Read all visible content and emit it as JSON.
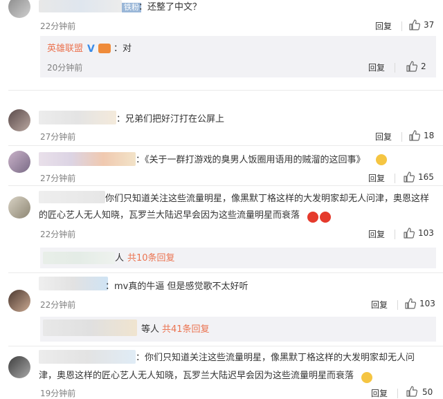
{
  "comments": [
    {
      "user_tag": "铁粉",
      "text": "：还整了中文？",
      "time": "22分钟前",
      "reply": "回复",
      "likes": "37"
    },
    {
      "username": "英雄联盟",
      "text": "：对",
      "time": "20分钟前",
      "reply": "回复",
      "likes": "2"
    },
    {
      "text": "：兄弟们把好汀打在公屏上",
      "time": "27分钟前",
      "reply": "回复",
      "likes": "18"
    },
    {
      "text": "：《关于一群打游戏的臭男人饭圈用语用的贼溜的这回事》",
      "time": "27分钟前",
      "reply": "回复",
      "likes": "165"
    },
    {
      "text_line1": "你们只知道关注这些流量明星，像黑默丁格这样的大发明家却无人问津，奥恩这样",
      "text_line2": "的匠心艺人无人知晓，瓦罗兰大陆迟早会因为这些流量明星而衰落",
      "time": "22分钟前",
      "reply": "回复",
      "likes": "103",
      "more_text": "人",
      "more_link": "共10条回复"
    },
    {
      "text": "：mv真的牛逼 但是感觉歌不太好听",
      "time": "22分钟前",
      "reply": "回复",
      "likes": "103",
      "more_text": "等人",
      "more_link": "共41条回复"
    },
    {
      "text_line1": "：你们只知道关注这些流量明星，像黑默丁格这样的大发明家却无人问",
      "text_line2": "津，奥恩这样的匠心艺人无人知晓，瓦罗兰大陆迟早会因为这些流量明星而衰落",
      "time": "19分钟前",
      "reply": "回复",
      "likes": "50"
    }
  ]
}
